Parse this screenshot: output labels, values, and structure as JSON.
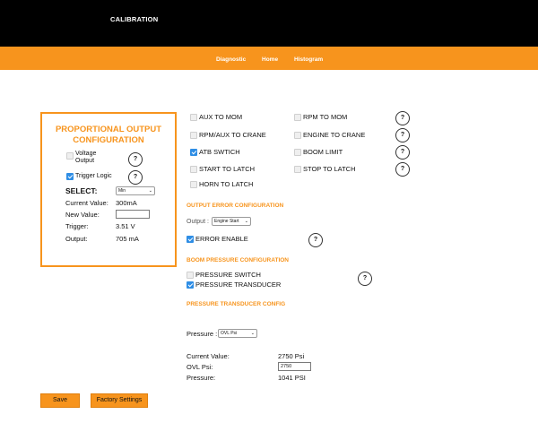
{
  "header": {
    "title": "CALIBRATION"
  },
  "nav": {
    "diagnostic": "Diagnostic",
    "home": "Home",
    "histogram": "Histogram"
  },
  "panel": {
    "title_line1": "PROPORTIONAL OUTPUT",
    "title_line2": "CONFIGURATION",
    "voltage_output_line1": "Voltage",
    "voltage_output_line2": "Output",
    "trigger_logic": "Trigger Logic",
    "select_label": "SELECT:",
    "select_value": "Min",
    "current_value_label": "Current Value:",
    "current_value": "300mA",
    "new_value_label": "New Value:",
    "new_value": "",
    "trigger_label": "Trigger:",
    "trigger_value": "3.51 V",
    "output_label": "Output:",
    "output_value": "705 mA"
  },
  "toggles": {
    "aux_to_mom": "AUX TO MOM",
    "rpm_to_mom": "RPM TO MOM",
    "rpm_aux_to_crane": "RPM/AUX TO CRANE",
    "engine_to_crane": "ENGINE TO CRANE",
    "atb_switch": "ATB SWTICH",
    "boom_limit": "BOOM LIMIT",
    "start_to_latch": "START TO LATCH",
    "stop_to_latch": "STOP TO LATCH",
    "horn_to_latch": "HORN TO LATCH"
  },
  "output_error": {
    "section_title": "OUTPUT ERROR CONFIGURATION",
    "output_label": "Output :",
    "output_value": "Engine Start",
    "error_enable": "ERROR ENABLE"
  },
  "boom_pressure": {
    "section_title": "BOOM PRESSURE CONFIGURATION",
    "pressure_switch": "PRESSURE SWITCH",
    "pressure_transducer": "PRESSURE TRANSDUCER"
  },
  "transducer": {
    "section_title": "PRESSURE TRANSDUCER CONFIG",
    "pressure_label": "Pressure :",
    "pressure_value": "OVL Psi",
    "current_value_label": "Current Value:",
    "current_value": "2750 Psi",
    "ovl_psi_label": "OVL Psi:",
    "ovl_psi_value": "2750",
    "pressure_reading_label": "Pressure:",
    "pressure_reading": "1041 PSI"
  },
  "help_symbol": "?",
  "chevron_symbol": "⌄",
  "buttons": {
    "save": "Save",
    "factory_settings": "Factory Settings"
  },
  "colors": {
    "accent": "#f7941d",
    "header_bg": "#000000",
    "checkbox_checked": "#2f8ee5"
  }
}
